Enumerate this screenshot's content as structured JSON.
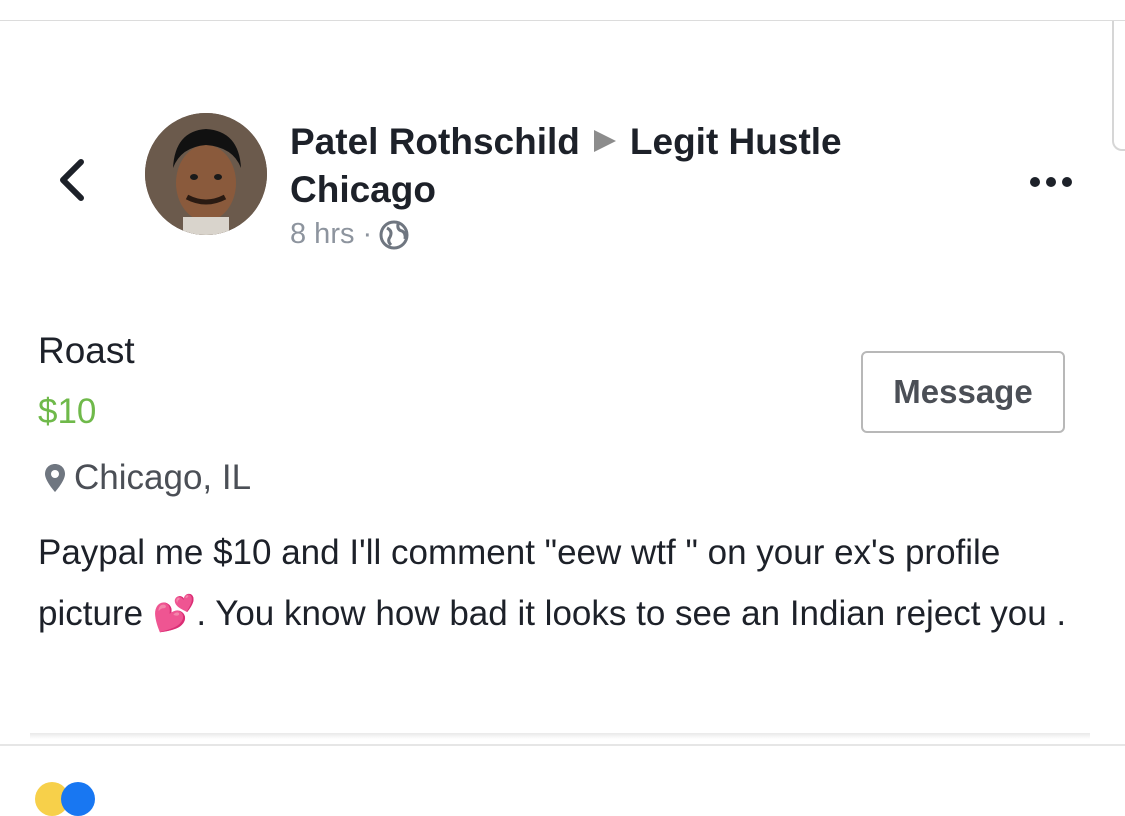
{
  "post": {
    "author": "Patel Rothschild",
    "group": "Legit Hustle",
    "group_line2": "Chicago",
    "time": "8 hrs ·",
    "visibility_icon": "globe-icon"
  },
  "listing": {
    "title": "Roast",
    "price": "$10",
    "location": "Chicago, IL",
    "message_label": "Message",
    "description_part1": "Paypal me $10 and I'll comment  \"eew wtf \" on your ex's profile picture ",
    "emoji": "💕",
    "description_part2": ". You know how bad it looks to see an Indian reject you ."
  },
  "colors": {
    "price": "#6fb94a",
    "emoji": "#e0479c"
  },
  "icons": {
    "back": "chevron-left-icon",
    "more": "more-icon",
    "location": "location-pin-icon"
  }
}
